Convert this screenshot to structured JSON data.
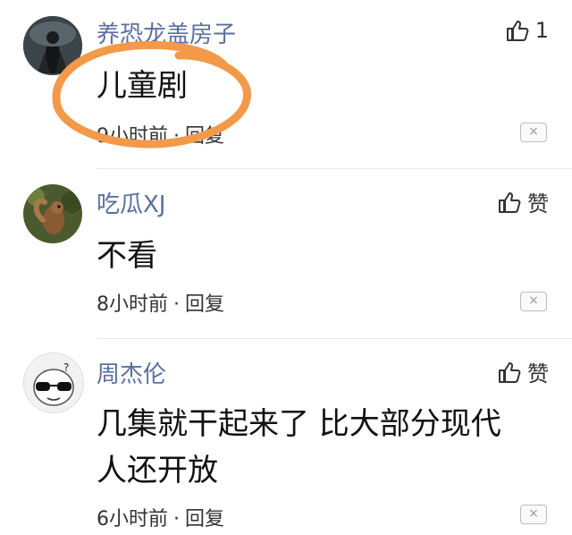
{
  "comments": [
    {
      "author": "养恐龙盖房子",
      "text": "儿童剧",
      "time": "9小时前",
      "reply": "回复",
      "like": "1",
      "close": "×",
      "avatar": "dark-knight-avatar"
    },
    {
      "author": "吃瓜XJ",
      "text": "不看",
      "time": "8小时前",
      "reply": "回复",
      "like": "赞",
      "close": "×",
      "avatar": "squirrel-avatar"
    },
    {
      "author": "周杰伦",
      "text_line1": "几集就干起来了 比大部分现代",
      "text_line2": "人还开放",
      "time": "6小时前",
      "reply": "回复",
      "like": "赞",
      "close": "×",
      "avatar": "meme-face-avatar"
    }
  ],
  "separator": "·",
  "colors": {
    "author": "#5b6fa0",
    "highlight_circle": "#f29a4a"
  }
}
